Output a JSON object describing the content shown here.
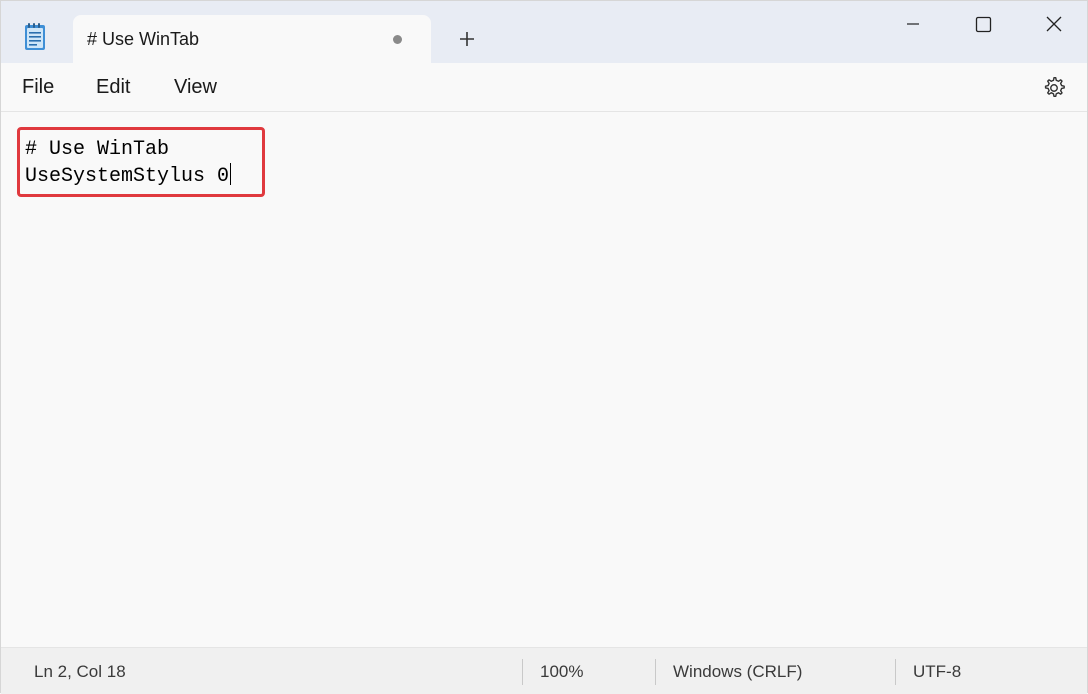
{
  "tab": {
    "title": "# Use WinTab"
  },
  "menu": {
    "file": "File",
    "edit": "Edit",
    "view": "View"
  },
  "editor": {
    "line1": "# Use WinTab",
    "line2": "UseSystemStylus 0"
  },
  "status": {
    "position": "Ln 2, Col 18",
    "zoom": "100%",
    "line_ending": "Windows (CRLF)",
    "encoding": "UTF-8"
  },
  "icons": {
    "app": "notepad-icon",
    "new_tab": "plus-icon",
    "minimize": "minimize-icon",
    "maximize": "maximize-icon",
    "close": "close-icon",
    "settings": "gear-icon",
    "unsaved": "unsaved-dot-icon"
  },
  "colors": {
    "highlight": "#e0393e",
    "titlebar": "#e8ecf4"
  }
}
